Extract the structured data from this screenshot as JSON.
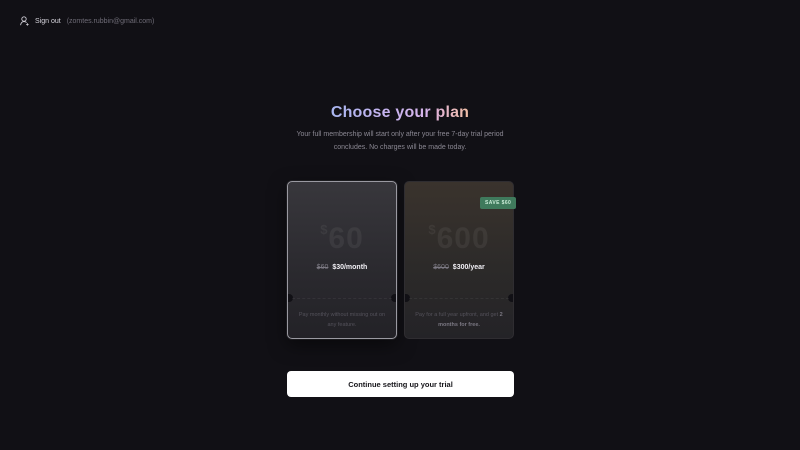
{
  "header": {
    "signout_label": "Sign out",
    "email": "(zomtes.rubbin@gmail.com)",
    "user_icon": "user-icon"
  },
  "heading": {
    "part1": "Choose your ",
    "part2": "plan",
    "subtitle": "Your full membership will start only after your free 7-day trial period concludes. No charges will be made today."
  },
  "plans": [
    {
      "big_currency": "$",
      "big_amount": "60",
      "old_price": "$60",
      "new_price": "$30/month",
      "desc": "Pay monthly without missing out on any feature.",
      "selected": true
    },
    {
      "big_currency": "$",
      "big_amount": "600",
      "old_price": "$600",
      "new_price": "$300/year",
      "desc_prefix": "Pay for a full year upfront, and get",
      "desc_bold": "2 months for free.",
      "badge": "SAVE $60",
      "selected": false
    }
  ],
  "cta": {
    "label": "Continue setting up your trial"
  },
  "colors": {
    "background": "#111015",
    "badge": "#3f7a5c",
    "cta": "#ffffff"
  }
}
